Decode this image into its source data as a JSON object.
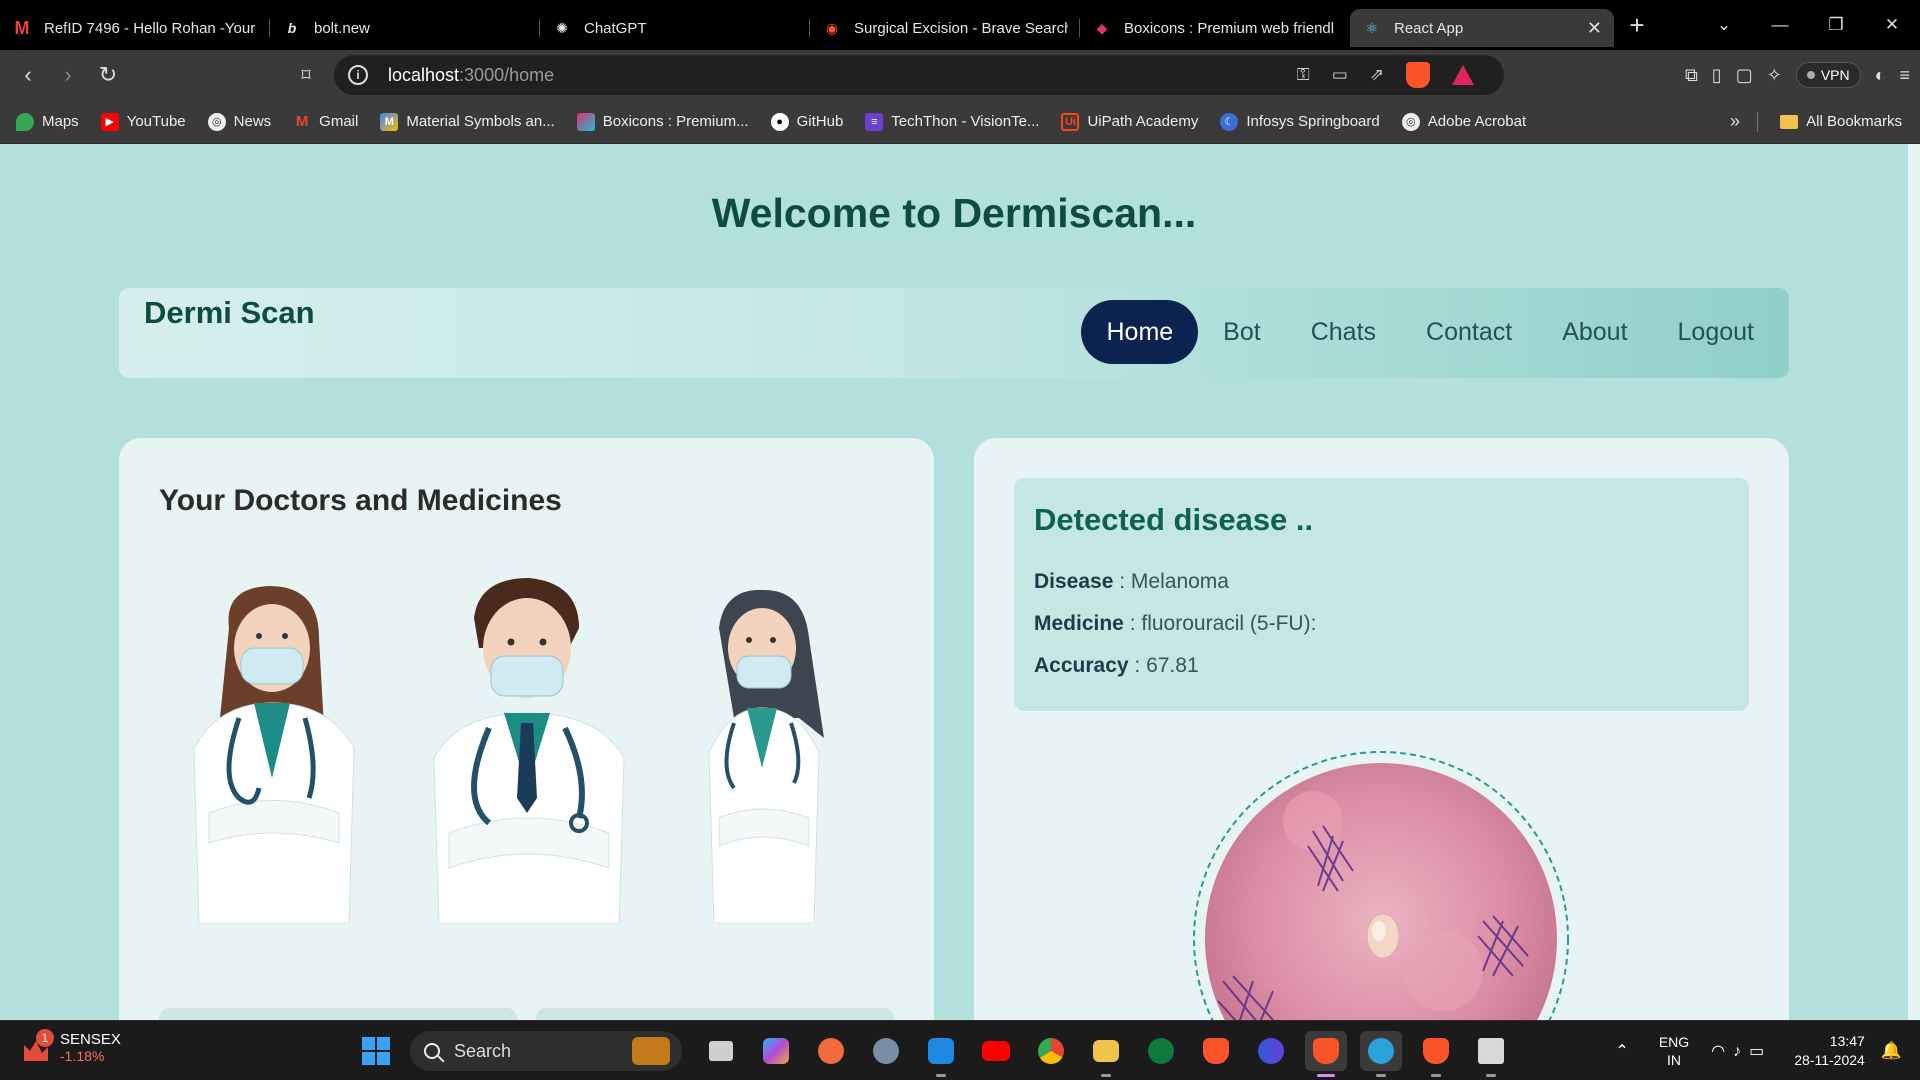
{
  "browser": {
    "tabs": [
      {
        "title": "RefID 7496 - Hello Rohan -Your",
        "icon": "gmail-icon"
      },
      {
        "title": "bolt.new",
        "icon": "bolt-icon"
      },
      {
        "title": "ChatGPT",
        "icon": "chatgpt-icon"
      },
      {
        "title": "Surgical Excision - Brave Search",
        "icon": "brave-search-icon"
      },
      {
        "title": "Boxicons : Premium web friendl",
        "icon": "boxicons-icon"
      },
      {
        "title": "React App",
        "icon": "react-icon",
        "active": true
      }
    ],
    "url_host": "localhost",
    "url_path": ":3000/home",
    "vpn_label": "VPN",
    "bookmarks": [
      "Maps",
      "YouTube",
      "News",
      "Gmail",
      "Material Symbols an...",
      "Boxicons : Premium...",
      "GitHub",
      "TechThon - VisionTe...",
      "UiPath Academy",
      "Infosys Springboard",
      "Adobe Acrobat"
    ],
    "all_bookmarks_label": "All Bookmarks"
  },
  "page": {
    "welcome": "Welcome to Dermiscan...",
    "brand": "Dermi Scan",
    "menu": [
      "Home",
      "Bot",
      "Chats",
      "Contact",
      "About",
      "Logout"
    ],
    "active_menu": "Home",
    "doctors_title": "Your Doctors and Medicines",
    "detection": {
      "title": "Detected disease ..",
      "disease_label": "Disease",
      "disease_value": "Melanoma",
      "medicine_label": "Medicine",
      "medicine_value": "fluorouracil (5-FU):",
      "accuracy_label": "Accuracy",
      "accuracy_value": "67.81"
    }
  },
  "taskbar": {
    "ticker_name": "SENSEX",
    "ticker_change": "-1.18%",
    "ticker_badge": "1",
    "search_label": "Search",
    "lang_1": "ENG",
    "lang_2": "IN",
    "time": "13:47",
    "date": "28-11-2024"
  },
  "colors": {
    "page_bg": "#b3dfdc",
    "heading": "#0d4d3f",
    "active_nav": "#0c2350",
    "card_bg": "#e7f4f3",
    "detect_box": "#c6e6e3"
  }
}
